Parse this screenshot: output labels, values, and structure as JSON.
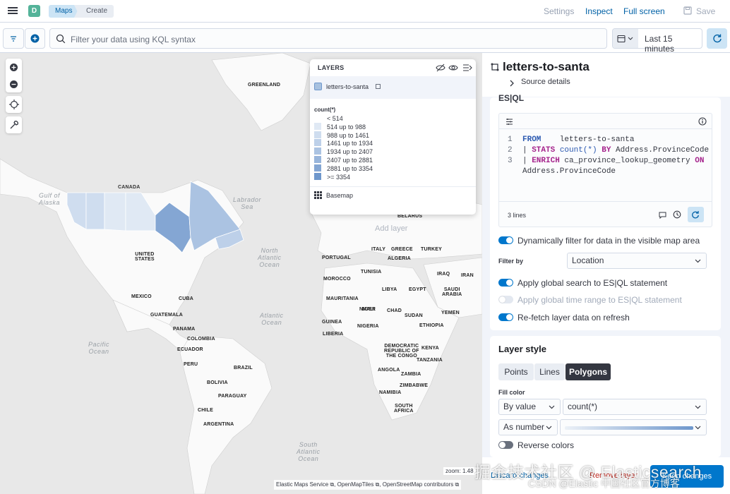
{
  "app_badge": "D",
  "breadcrumbs": [
    "Maps",
    "Create"
  ],
  "top_links": {
    "settings": "Settings",
    "inspect": "Inspect",
    "full_screen": "Full screen",
    "save": "Save"
  },
  "query": {
    "placeholder": "Filter your data using KQL syntax",
    "time_range": "Last 15 minutes"
  },
  "layers_panel": {
    "title": "LAYERS",
    "layer_name": "letters-to-santa",
    "legend_title": "count(*)",
    "legend": [
      {
        "label": "< 514",
        "color": ""
      },
      {
        "label": "514 up to 988",
        "color": "#e0e9f4"
      },
      {
        "label": "988 up to 1461",
        "color": "#cfddef"
      },
      {
        "label": "1461 up to 1934",
        "color": "#bdd0e9"
      },
      {
        "label": "1934 up to 2407",
        "color": "#abc3e2"
      },
      {
        "label": "2407 up to 2881",
        "color": "#98b5db"
      },
      {
        "label": "2881 up to 3354",
        "color": "#84a6d3"
      },
      {
        "label": ">= 3354",
        "color": "#6e97cc"
      }
    ],
    "basemap": "Basemap"
  },
  "map_labels": {
    "greenland": "GREENLAND",
    "canada": "CANADA",
    "gulf_of_alaska": "Gulf of\nAlaska",
    "labrador_sea": "Labrador\nSea",
    "united_states": "UNITED\nSTATES",
    "mexico": "MEXICO",
    "cuba": "CUBA",
    "guatemala": "GUATEMALA",
    "panama": "PANAMA",
    "colombia": "COLOMBIA",
    "ecuador": "ECUADOR",
    "peru": "PERU",
    "brazil": "BRAZIL",
    "bolivia": "BOLIVIA",
    "paraguay": "PARAGUAY",
    "chile": "CHILE",
    "argentina": "ARGENTINA",
    "pacific_ocean": "Pacific\nOcean",
    "north_atlantic": "North\nAtlantic\nOcean",
    "atlantic_ocean": "Atlantic\nOcean",
    "south_atlantic": "South\nAtlantic\nOcean",
    "portugal": "PORTUGAL",
    "italy": "ITALY",
    "algeria": "ALGERIA",
    "greece": "GREECE",
    "turkey": "TURKEY",
    "morocco": "MOROCCO",
    "tunisia": "TUNISIA",
    "iraq": "IRAQ",
    "iran": "IRAN",
    "libya": "LIBYA",
    "egypt": "EGYPT",
    "saudi_arabia": "SAUDI\nARABIA",
    "mauritania": "MAURITANIA",
    "mali": "MALI",
    "niger": "NIGER",
    "chad": "CHAD",
    "sudan": "SUDAN",
    "yemen": "YEMEN",
    "guinea": "GUINEA",
    "nigeria": "NIGERIA",
    "ethiopia": "ETHIOPIA",
    "liberia": "LIBERIA",
    "drc": "DEMOCRATIC\nREPUBLIC OF\nTHE CONGO",
    "kenya": "KENYA",
    "tanzania": "TANZANIA",
    "angola": "ANGOLA",
    "zambia": "ZAMBIA",
    "namibia": "NAMIBIA",
    "zimbabwe": "ZIMBABWE",
    "south_africa": "SOUTH\nAFRICA",
    "belarus": "BELARUS",
    "add_layer": "Add layer"
  },
  "map_footer": {
    "zoom": "zoom: 1.48",
    "attr1": "Elastic Maps Service",
    "attr2": "OpenMapTiles",
    "attr3": "OpenStreetMap contributors"
  },
  "panel": {
    "title": "letters-to-santa",
    "source_details": "Source details",
    "esql_heading": "ES|QL",
    "code_lines": [
      "1",
      "2",
      "3"
    ],
    "lines_count": "3 lines",
    "toggles": [
      {
        "label": "Dynamically filter for data in the visible map area",
        "on": true
      },
      {
        "label": "Apply global search to ES|QL statement",
        "on": true
      },
      {
        "label": "Apply global time range to ES|QL statement",
        "on": false
      },
      {
        "label": "Re-fetch layer data on refresh",
        "on": true
      }
    ],
    "filter_by_label": "Filter by",
    "filter_by_value": "Location",
    "layer_style_heading": "Layer style",
    "style_tabs": [
      "Points",
      "Lines",
      "Polygons"
    ],
    "fill_color_label": "Fill color",
    "fill_mode": "By value",
    "fill_field": "count(*)",
    "number_mode": "As number",
    "reverse_colors": "Reverse colors",
    "discard": "Discard changes",
    "remove": "Remove layer",
    "keep": "Keep changes"
  },
  "watermark": "掘金技术社区 @ Elasticsearch",
  "watermark2": "CSDN @Elastic 中国社区官方博客",
  "colors": {
    "accent": "#0077cc",
    "toggle_on": "#0077cc",
    "choropleth_dark": "#6e97cc"
  }
}
